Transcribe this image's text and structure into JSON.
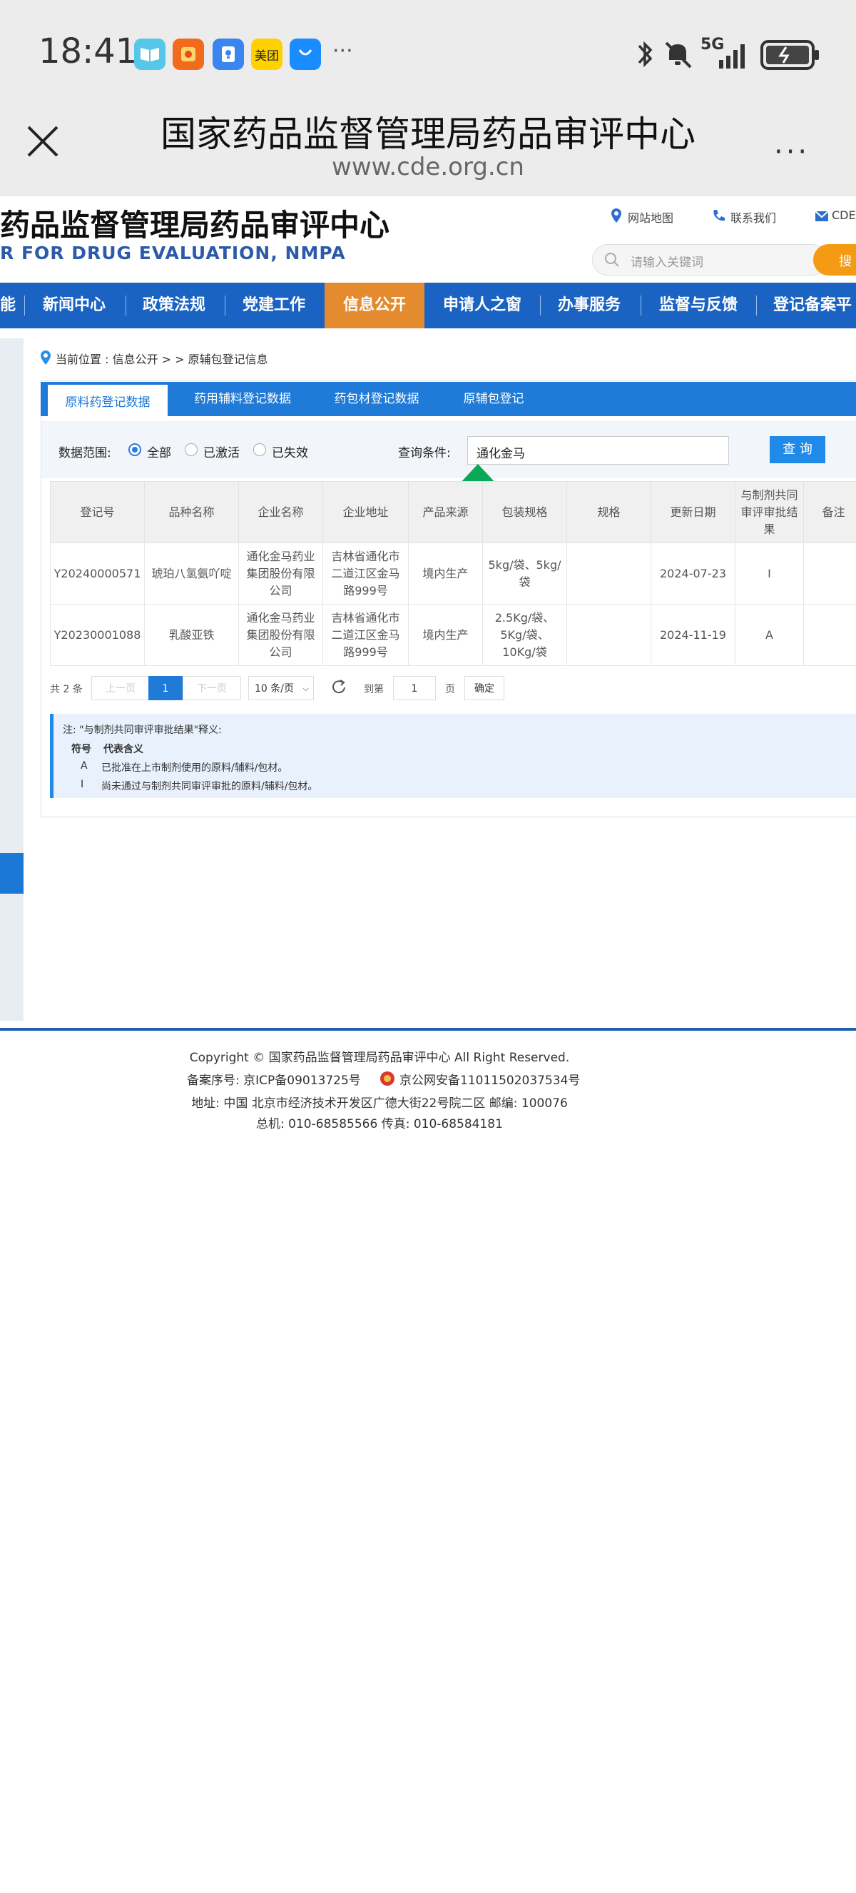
{
  "status": {
    "time": "18:41",
    "apps": [
      {
        "icon": "book-icon",
        "color": "#56c7e8",
        "label": ""
      },
      {
        "icon": "redbag-icon",
        "color": "#f26b1d",
        "label": ""
      },
      {
        "icon": "lightbulb-icon",
        "color": "#3a86f0",
        "label": ""
      },
      {
        "icon": "meituan-icon",
        "color": "#ffd100",
        "label": "美团"
      },
      {
        "icon": "honor-store-icon",
        "color": "#1a8cff",
        "label": ""
      }
    ],
    "more": "···",
    "signal": "5G"
  },
  "browser": {
    "title": "国家药品监督管理局药品审评中心",
    "url": "www.cde.org.cn",
    "more": "···"
  },
  "site": {
    "name": "药品监督管理局药品审评中心",
    "name_en": "R FOR DRUG EVALUATION, NMPA",
    "links": [
      "网站地图",
      "联系我们",
      "CDE"
    ],
    "search_placeholder": "请输入关键词",
    "search_button": "搜"
  },
  "nav": [
    "能",
    "新闻中心",
    "政策法规",
    "党建工作",
    "信息公开",
    "申请人之窗",
    "办事服务",
    "监督与反馈",
    "登记备案平"
  ],
  "nav_active": "信息公开",
  "breadcrumb": "当前位置 : 信息公开 > > 原辅包登记信息",
  "tabs": [
    "原料药登记数据",
    "药用辅料登记数据",
    "药包材登记数据",
    "原辅包登记"
  ],
  "filter": {
    "scope_label": "数据范围:",
    "options": [
      "全部",
      "已激活",
      "已失效"
    ],
    "selected": "全部",
    "query_label": "查询条件:",
    "query_value": "通化金马",
    "query_button": "查 询"
  },
  "table": {
    "headers": [
      "登记号",
      "品种名称",
      "企业名称",
      "企业地址",
      "产品来源",
      "包装规格",
      "规格",
      "更新日期",
      "与制剂共同审评审批结果",
      "备注"
    ],
    "rows": [
      [
        "Y20240000571",
        "琥珀八氢氨吖啶",
        "通化金马药业集团股份有限公司",
        "吉林省通化市二道江区金马路999号",
        "境内生产",
        "5kg/袋、5kg/袋",
        "",
        "2024-07-23",
        "I",
        ""
      ],
      [
        "Y20230001088",
        "乳酸亚铁",
        "通化金马药业集团股份有限公司",
        "吉林省通化市二道江区金马路999号",
        "境内生产",
        "2.5Kg/袋、5Kg/袋、10Kg/袋",
        "",
        "2024-11-19",
        "A",
        ""
      ]
    ]
  },
  "pager": {
    "total": "共 2 条",
    "prev": "上一页",
    "page": "1",
    "next": "下一页",
    "size": "10 条/页",
    "goto": "到第",
    "goto_value": "1",
    "page_unit": "页",
    "confirm": "确定"
  },
  "note": {
    "title": "注: \"与制剂共同审评审批结果\"释义:",
    "header_symbol": "符号",
    "header_meaning": "代表含义",
    "items": [
      {
        "symbol": "A",
        "meaning": "已批准在上市制剂使用的原料/辅料/包材。"
      },
      {
        "symbol": "I",
        "meaning": "尚未通过与制剂共同审评审批的原料/辅料/包材。"
      }
    ]
  },
  "footer": {
    "copyright": "Copyright © 国家药品监督管理局药品审评中心   All Right Reserved.",
    "icp": "备案序号: 京ICP备09013725号",
    "police": "京公网安备11011502037534号",
    "address": "地址: 中国 北京市经济技术开发区广德大街22号院二区      邮编: 100076",
    "phone": "总机: 010-68585566      传真: 010-68584181"
  },
  "colors": {
    "nav": "#1b63c3",
    "nav_active": "#e38b2e",
    "tab": "#1f7ad8",
    "accent": "#1f8ae8"
  }
}
